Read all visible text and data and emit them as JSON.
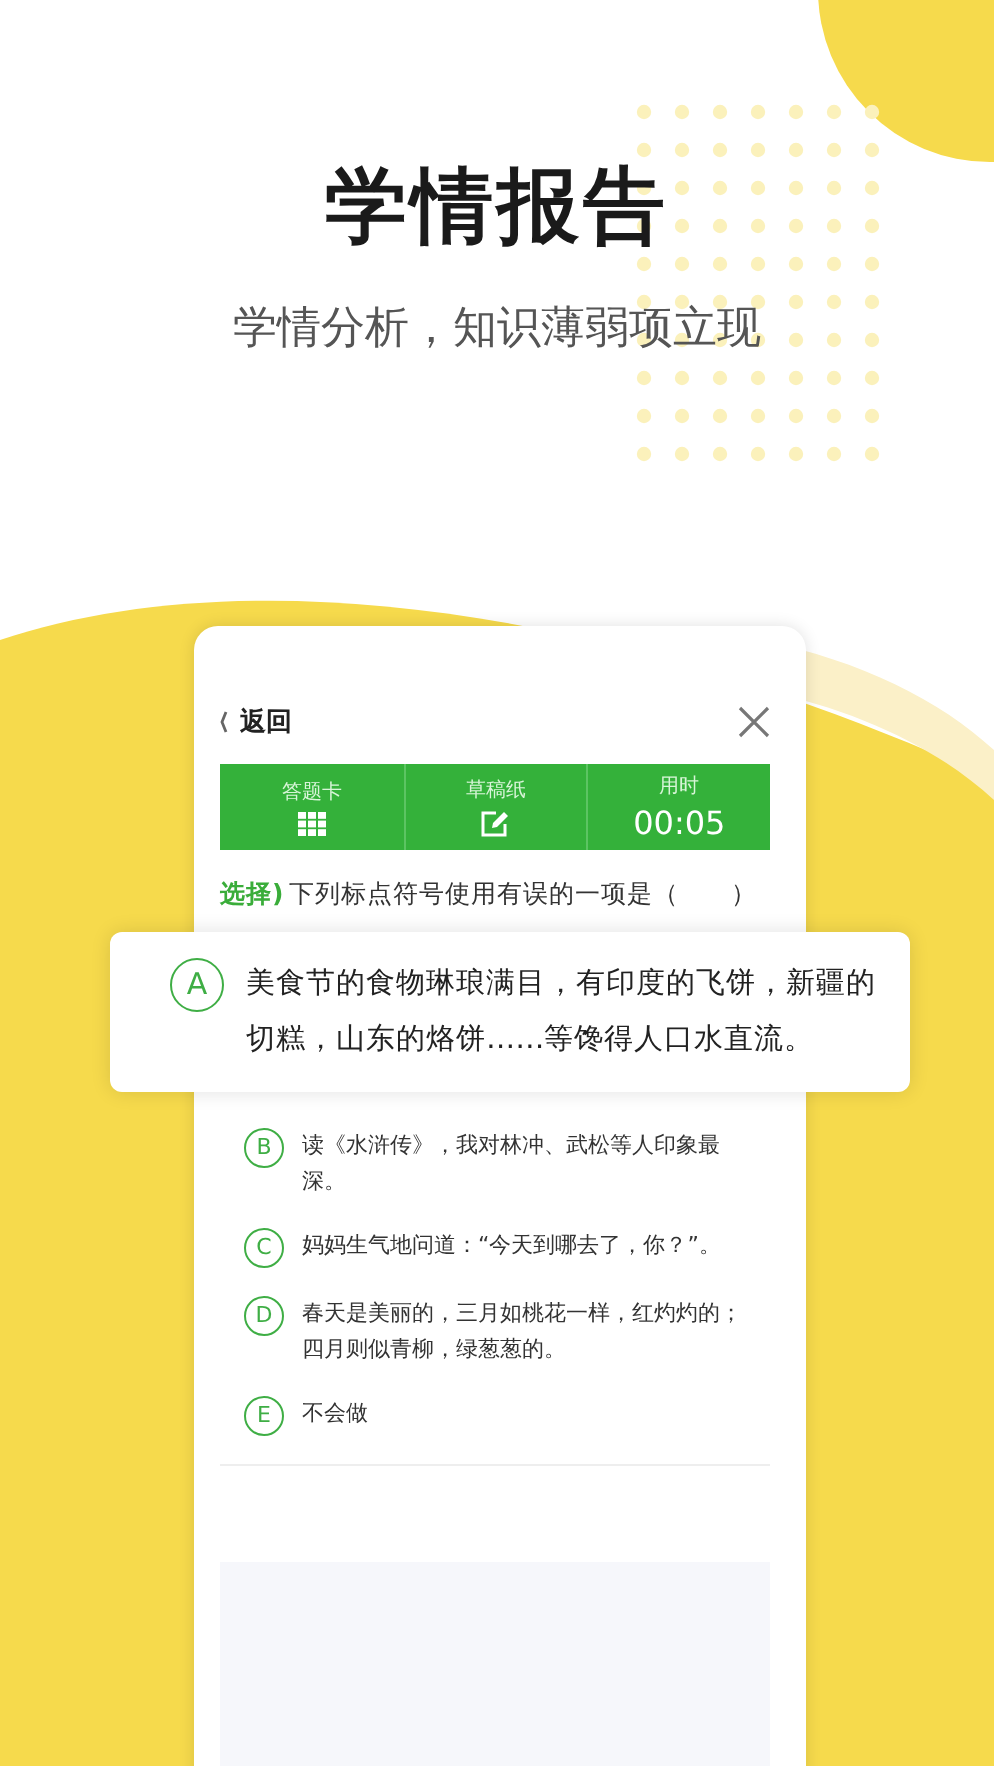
{
  "headline": {
    "title": "学情报告",
    "subtitle": "学情分析，知识薄弱项立现"
  },
  "screen": {
    "back_label": "返回",
    "toolbar": [
      {
        "kind": "grid",
        "label": "答题卡"
      },
      {
        "kind": "edit",
        "label": "草稿纸"
      },
      {
        "kind": "timer",
        "label": "用时",
        "value": "00:05"
      }
    ],
    "question_type": "选择)",
    "question": "下列标点符号使用有误的一项是（　　）",
    "options": [
      {
        "letter": "A",
        "text": "美食节的食物琳琅满目，有印度的飞饼，新疆的切糕，山东的烙饼……等馋得人口水直流。",
        "highlighted": true
      },
      {
        "letter": "B",
        "text": "读《水浒传》，我对林冲、武松等人印象最深。",
        "highlighted": false
      },
      {
        "letter": "C",
        "text": "妈妈生气地问道：“今天到哪去了，你？”。",
        "highlighted": false
      },
      {
        "letter": "D",
        "text": "春天是美丽的，三月如桃花一样，红灼灼的；四月则似青柳，绿葱葱的。",
        "highlighted": false
      },
      {
        "letter": "E",
        "text": "不会做",
        "highlighted": false
      }
    ]
  }
}
